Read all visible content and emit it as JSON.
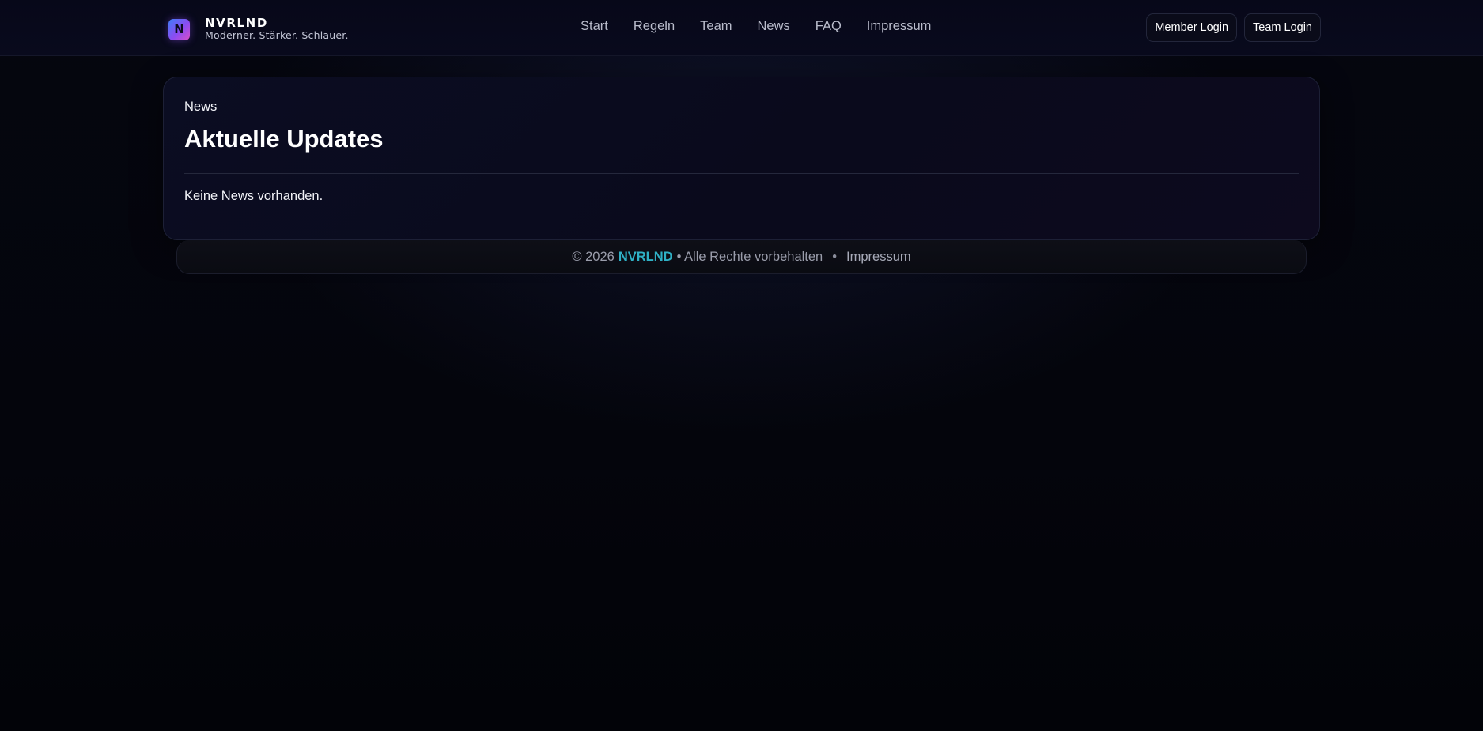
{
  "header": {
    "logo_letter": "N",
    "brand_name": "NVRLND",
    "tagline": "Moderner. Stärker. Schlauer.",
    "nav": [
      {
        "label": "Start"
      },
      {
        "label": "Regeln"
      },
      {
        "label": "Team"
      },
      {
        "label": "News"
      },
      {
        "label": "FAQ"
      },
      {
        "label": "Impressum"
      }
    ],
    "member_login_label": "Member Login",
    "team_login_label": "Team Login"
  },
  "main": {
    "kicker": "News",
    "title": "Aktuelle Updates",
    "empty_message": "Keine News vorhanden."
  },
  "footer": {
    "copyright": "© 2026",
    "brand": "NVRLND",
    "rights": "• Alle Rechte vorbehalten",
    "separator": "•",
    "impressum_label": "Impressum"
  },
  "colors": {
    "accent_footer_brand": "#2fb0c5",
    "logo_gradient_start": "#3f7df5",
    "logo_gradient_end": "#d94fc7",
    "background": "#04050c"
  }
}
